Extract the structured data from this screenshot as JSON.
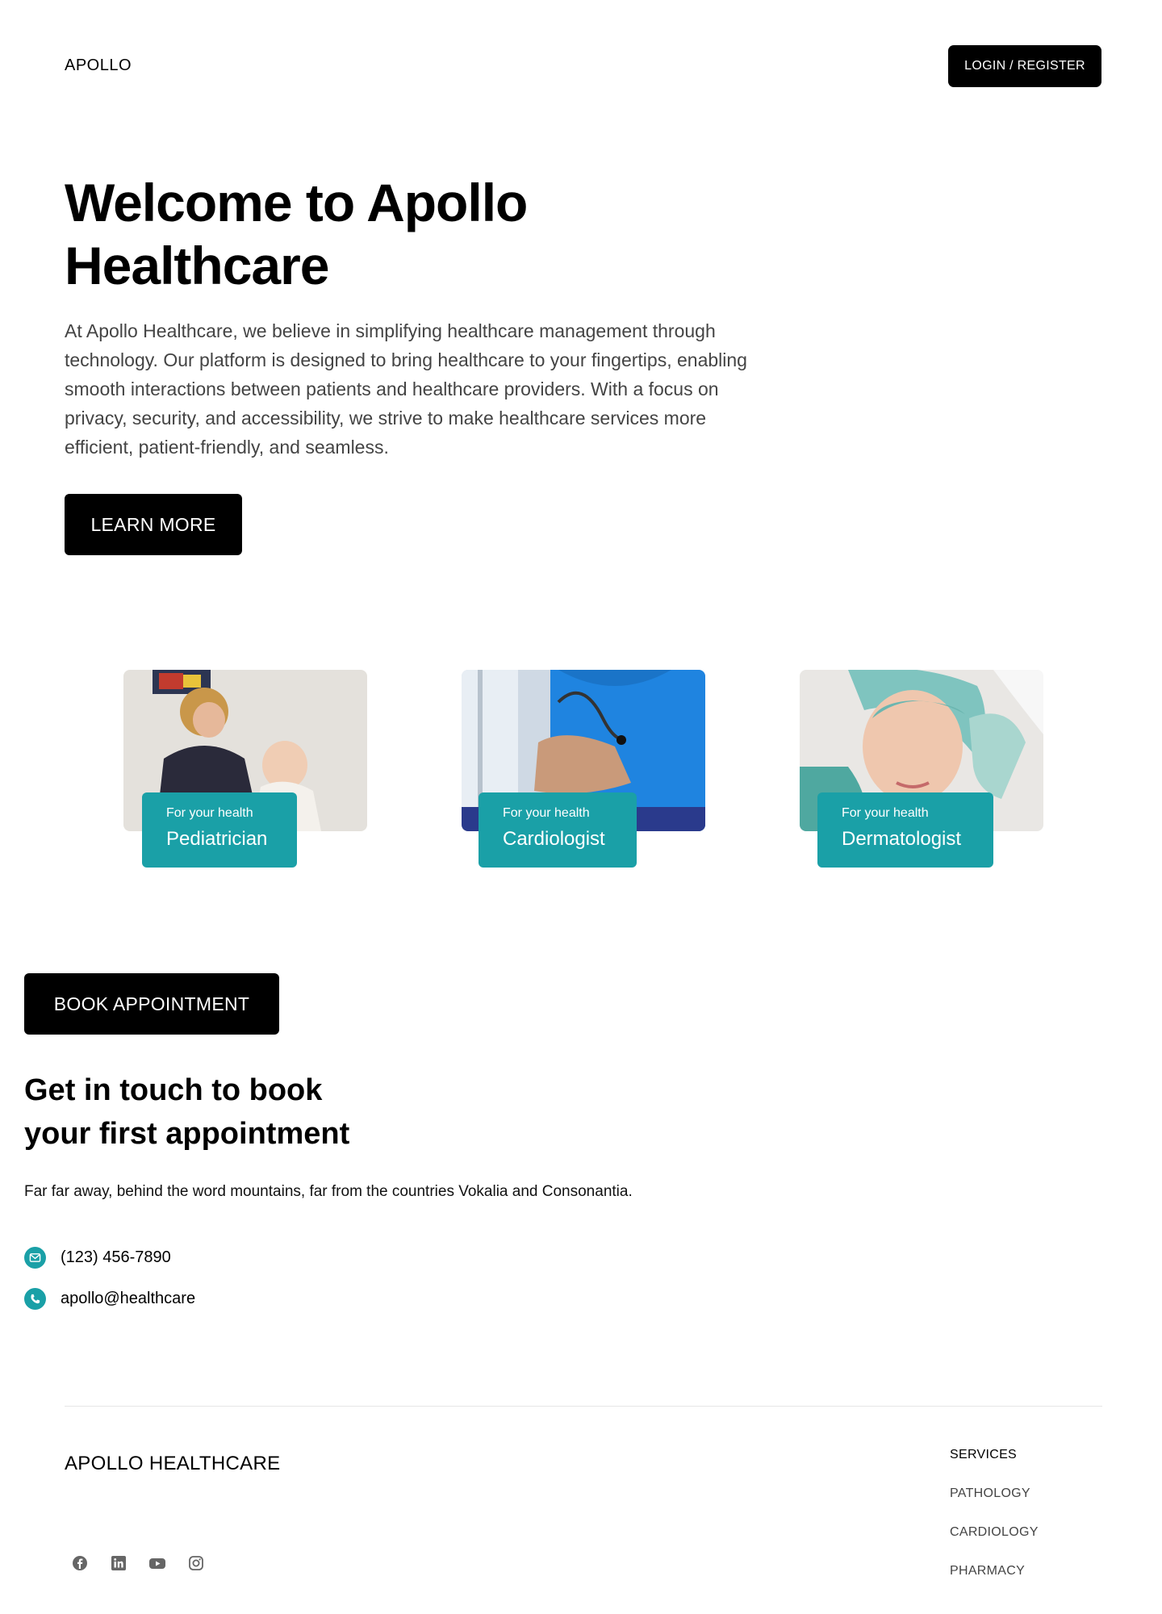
{
  "header": {
    "logo": "APOLLO",
    "login_label": "LOGIN / REGISTER"
  },
  "hero": {
    "title": "Welcome to Apollo Healthcare",
    "description": "At Apollo Healthcare, we believe in simplifying healthcare management through technology. Our platform is designed to bring healthcare to your fingertips, enabling smooth interactions between patients and healthcare providers. With a focus on privacy, security, and accessibility, we strive to make healthcare services more efficient, patient-friendly, and seamless.",
    "cta_label": "LEARN MORE"
  },
  "specialties": [
    {
      "tagline": "For your health",
      "name": "Pediatrician"
    },
    {
      "tagline": "For your health",
      "name": "Cardiologist"
    },
    {
      "tagline": "For your health",
      "name": "Dermatologist"
    }
  ],
  "booking": {
    "button_label": "BOOK APPOINTMENT",
    "title_line1": "Get in touch to book",
    "title_line2": "your first appointment",
    "description": "Far far away, behind the word mountains, far from the countries Vokalia and Consonantia.",
    "phone": "(123) 456-7890",
    "email": "apollo@healthcare",
    "phone_row_icon": "mail-icon",
    "email_row_icon": "phone-icon"
  },
  "footer": {
    "brand": "APOLLO HEALTHCARE",
    "services_heading": "SERVICES",
    "services": [
      "PATHOLOGY",
      "CARDIOLOGY",
      "PHARMACY"
    ],
    "socials": [
      "facebook-icon",
      "linkedin-icon",
      "youtube-icon",
      "instagram-icon"
    ]
  },
  "colors": {
    "accent": "#1aa0a7",
    "button": "#000000",
    "text_muted": "#444444"
  }
}
